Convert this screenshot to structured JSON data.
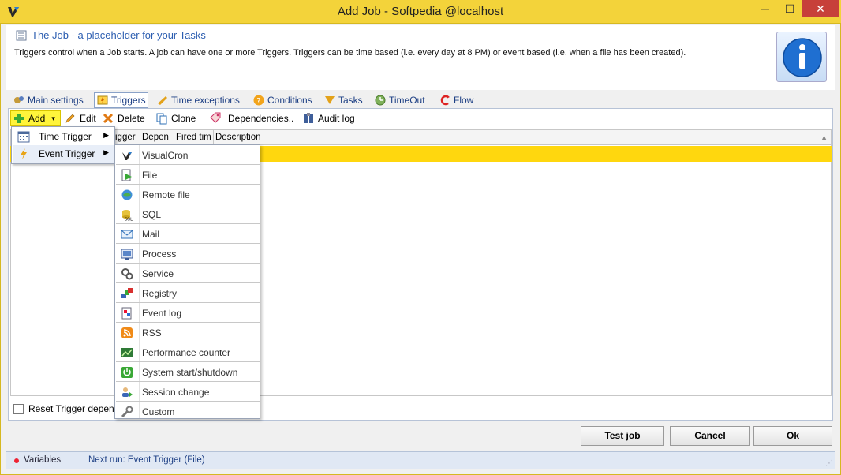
{
  "window": {
    "title": "Add Job - Softpedia @localhost",
    "minimize_glyph": "─",
    "maximize_glyph": "☐",
    "close_glyph": "✕"
  },
  "header": {
    "title": "The Job - a placeholder for your Tasks",
    "description": "Triggers control when a Job starts. A job can have one or more Triggers. Triggers can be time based (i.e. every day at 8 PM) or event based (i.e. when a file has been created)."
  },
  "tabs": [
    {
      "label": "Main settings",
      "icon": "gears-icon"
    },
    {
      "label": "Triggers",
      "icon": "triggers-icon",
      "active": true
    },
    {
      "label": "Time exceptions",
      "icon": "time-exceptions-icon"
    },
    {
      "label": "Conditions",
      "icon": "conditions-icon"
    },
    {
      "label": "Tasks",
      "icon": "tasks-icon"
    },
    {
      "label": "TimeOut",
      "icon": "timeout-icon"
    },
    {
      "label": "Flow",
      "icon": "flow-icon"
    }
  ],
  "toolbar": {
    "add": "Add",
    "edit": "Edit",
    "delete": "Delete",
    "clone": "Clone",
    "dependencies": "Dependencies..",
    "audit_log": "Audit log"
  },
  "grid": {
    "columns": [
      "igger",
      "Depen",
      "Fired tim",
      "Description"
    ]
  },
  "reset_trigger_label": "Reset Trigger depend",
  "buttons": {
    "test_job": "Test job",
    "cancel": "Cancel",
    "ok": "Ok"
  },
  "status": {
    "variables": "Variables",
    "next_run": "Next run: Event Trigger (File)"
  },
  "add_menu": [
    {
      "label": "Time Trigger",
      "icon": "calendar-icon"
    },
    {
      "label": "Event Trigger",
      "icon": "lightning-icon"
    }
  ],
  "event_menu": [
    {
      "label": "VisualCron",
      "icon": "visualcron-icon"
    },
    {
      "label": "File",
      "icon": "file-icon"
    },
    {
      "label": "Remote file",
      "icon": "remote-file-icon"
    },
    {
      "label": "SQL",
      "icon": "sql-icon"
    },
    {
      "label": "Mail",
      "icon": "mail-icon"
    },
    {
      "label": "Process",
      "icon": "process-icon"
    },
    {
      "label": "Service",
      "icon": "service-icon"
    },
    {
      "label": "Registry",
      "icon": "registry-icon"
    },
    {
      "label": "Event log",
      "icon": "event-log-icon"
    },
    {
      "label": "RSS",
      "icon": "rss-icon"
    },
    {
      "label": "Performance counter",
      "icon": "performance-counter-icon"
    },
    {
      "label": "System start/shutdown",
      "icon": "system-start-icon"
    },
    {
      "label": "Session change",
      "icon": "session-change-icon"
    },
    {
      "label": "Custom",
      "icon": "custom-icon"
    }
  ],
  "colors": {
    "title_bar": "#f3d33a",
    "selected_row": "#ffd70e",
    "add_button": "#fff43b",
    "link_blue": "#1d3f84"
  }
}
